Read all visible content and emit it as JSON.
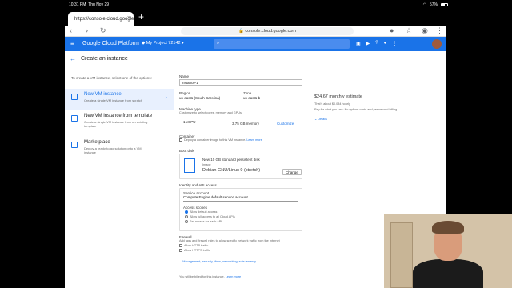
{
  "status": {
    "time": "10:31 PM",
    "date": "Thu Nov 29",
    "battery": "57%"
  },
  "browser": {
    "tab_title": "https://console.cloud.google",
    "url": "console.cloud.google.com"
  },
  "gcp": {
    "brand": "Google Cloud Platform",
    "project": "My Project 72142"
  },
  "page": {
    "title": "Create an instance",
    "intro": "To create a VM instance, select one of the options:"
  },
  "options": [
    {
      "title": "New VM instance",
      "desc": "Create a single VM instance from scratch"
    },
    {
      "title": "New VM instance from template",
      "desc": "Create a single VM instance from an existing template"
    },
    {
      "title": "Marketplace",
      "desc": "Deploy a ready-to-go solution onto a VM instance"
    }
  ],
  "form": {
    "name_label": "Name",
    "name_value": "instance-1",
    "region_label": "Region",
    "region_value": "us-east1 (South Carolina)",
    "zone_label": "Zone",
    "zone_value": "us-east1-b",
    "machine_label": "Machine type",
    "machine_hint": "Customize to select cores, memory and GPUs.",
    "cpu": "1 vCPU",
    "memory": "3.75 GB memory",
    "customize": "Customize",
    "container_label": "Container",
    "container_text": "Deploy a container image to this VM instance.",
    "learn_more": "Learn more",
    "boot_label": "Boot disk",
    "boot_title": "New 10 GB standard persistent disk",
    "boot_image_label": "Image",
    "boot_image": "Debian GNU/Linux 9 (stretch)",
    "change": "Change",
    "identity_label": "Identity and API access",
    "sa_label": "Service account",
    "sa_value": "Compute Engine default service account",
    "scopes_label": "Access scopes",
    "scope1": "Allow default access",
    "scope2": "Allow full access to all Cloud APIs",
    "scope3": "Set access for each API",
    "firewall_label": "Firewall",
    "firewall_hint": "Add tags and firewall rules to allow specific network traffic from the Internet",
    "http": "Allow HTTP traffic",
    "https": "Allow HTTPS traffic",
    "more": "Management, security, disks, networking, sole tenancy",
    "billed": "You will be billed for this instance."
  },
  "estimate": {
    "monthly": "$24.67 monthly estimate",
    "hourly": "That's about $0.034 hourly",
    "note": "Pay for what you use: No upfront costs and per second billing",
    "details": "Details"
  }
}
